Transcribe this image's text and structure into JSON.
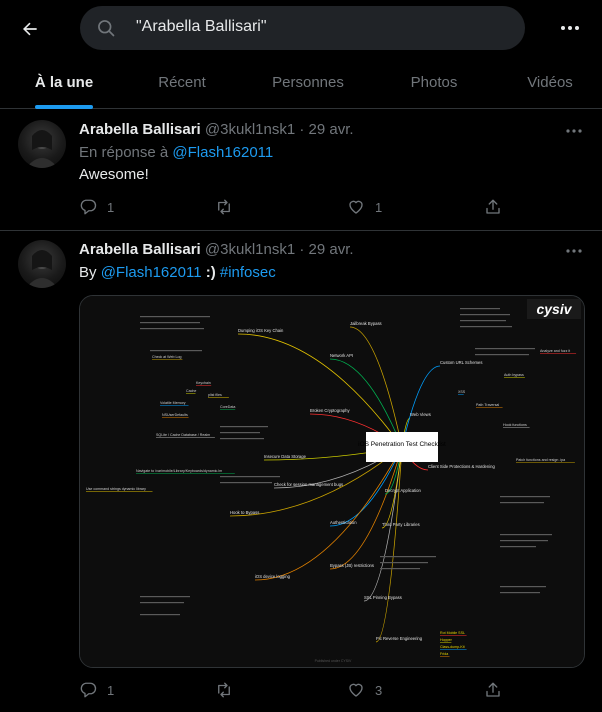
{
  "search": {
    "query": "\"Arabella Ballisari\""
  },
  "tabs": [
    {
      "label": "À la une"
    },
    {
      "label": "Récent"
    },
    {
      "label": "Personnes"
    },
    {
      "label": "Photos"
    },
    {
      "label": "Vidéos"
    }
  ],
  "tweets": [
    {
      "name": "Arabella Ballisari",
      "handle": "@3kukl1nsk1",
      "sep": " · ",
      "date": "29 avr.",
      "reply_prefix": "En réponse à ",
      "reply_to": "@Flash162011",
      "text": "Awesome!",
      "replies": "1",
      "retweets": "",
      "likes": "1"
    },
    {
      "name": "Arabella Ballisari",
      "handle": "@3kukl1nsk1",
      "sep": " · ",
      "date": "29 avr.",
      "by": "By ",
      "mention": "@Flash162011",
      "smile": " :) ",
      "hashtag": "#infosec",
      "replies": "1",
      "retweets": "",
      "likes": "3"
    }
  ],
  "mindmap": {
    "logo": "cysiv",
    "center": "iOS Penetration Test Checklist",
    "branches": [
      "Jailbreak Bypass",
      "Dumping iOS Key Chain",
      "Network API",
      "Broken Cryptography",
      "Insecure Data Storage",
      "Authentication",
      "Bypass (JB) restrictions",
      "SSL Pinning Bypass",
      "Pic Reverse Engineering",
      "Third Party Libraries",
      "Decrypt Application",
      "Client Side Protections & Hardening",
      "Web Views",
      "Custom URL Schemes",
      "iOS device logging",
      "Check for session management bugs",
      "Hook to Bypass"
    ],
    "leaves": [
      "Analyze and fuzz it",
      "Auth bypass",
      "XSS",
      "Path Traversal",
      "Hook functions",
      "Patch functions and resign .ipa",
      "plist files",
      "CoreData",
      "Keychain",
      "Cache",
      "Volatile Memory",
      "NSUserDefaults",
      "SQLite / Cache Database / Realm",
      "Check at Web Log",
      "Use command strings dynamic library",
      "Navigate to /var/mobile/Library/Keyboards/dynamic.lm",
      "Rot Mobile SSL",
      "Hopper",
      "Class-dump-Kit",
      "Frida"
    ],
    "footer": "Published under CYSIV"
  },
  "colors": {
    "accent": "#1d9bf0",
    "muted": "#71767b",
    "text": "#e7e9ea",
    "border": "#2f3336"
  },
  "icons": [
    "back-arrow-icon",
    "search-icon",
    "more-icon",
    "reply-icon",
    "retweet-icon",
    "like-icon",
    "share-icon"
  ]
}
